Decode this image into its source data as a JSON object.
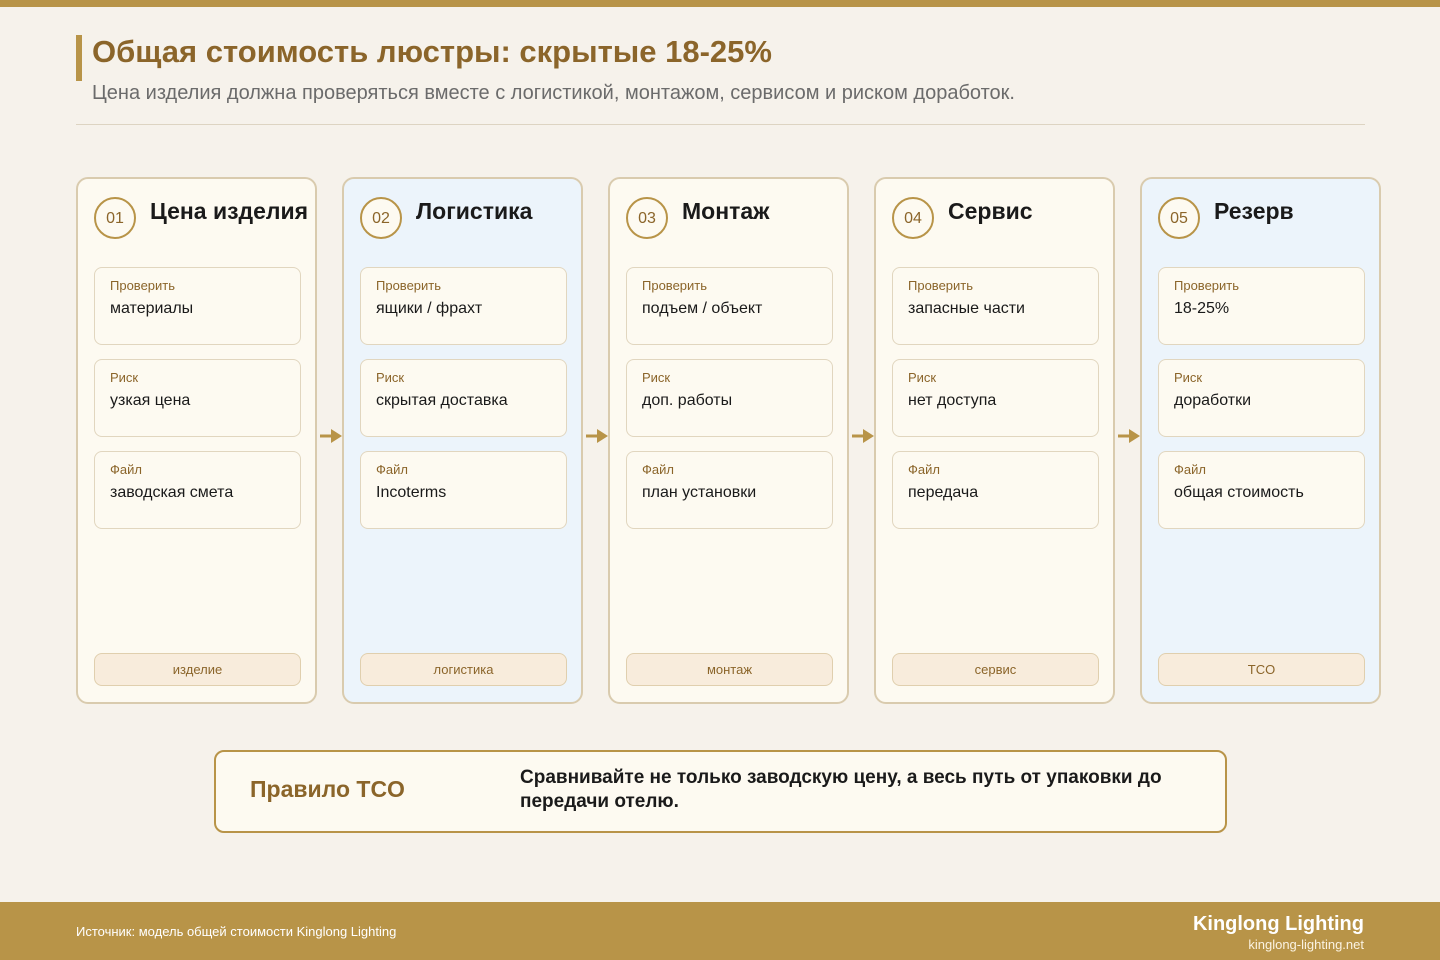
{
  "header": {
    "title": "Общая стоимость люстры: скрытые 18-25%",
    "subtitle": "Цена изделия должна проверяться вместе с логистикой, монтажом, сервисом и риском доработок."
  },
  "colors": {
    "accent": "#b89448",
    "accent_text": "#8b652a",
    "column_bg": "#fdfaf1",
    "column_bg_alt": "#ecf4fb",
    "page_bg": "#f6f2eb"
  },
  "columns": [
    {
      "num": "01",
      "title": "Цена изделия",
      "items": [
        {
          "label": "Проверить",
          "value": "материалы"
        },
        {
          "label": "Риск",
          "value": "узкая цена"
        },
        {
          "label": "Файл",
          "value": "заводская смета"
        }
      ],
      "tag": "изделие"
    },
    {
      "num": "02",
      "title": "Логистика",
      "items": [
        {
          "label": "Проверить",
          "value": "ящики / фрахт"
        },
        {
          "label": "Риск",
          "value": "скрытая доставка"
        },
        {
          "label": "Файл",
          "value": "Incoterms"
        }
      ],
      "tag": "логистика"
    },
    {
      "num": "03",
      "title": "Монтаж",
      "items": [
        {
          "label": "Проверить",
          "value": "подъем / объект"
        },
        {
          "label": "Риск",
          "value": "доп. работы"
        },
        {
          "label": "Файл",
          "value": "план установки"
        }
      ],
      "tag": "монтаж"
    },
    {
      "num": "04",
      "title": "Сервис",
      "items": [
        {
          "label": "Проверить",
          "value": "запасные части"
        },
        {
          "label": "Риск",
          "value": "нет доступа"
        },
        {
          "label": "Файл",
          "value": "передача"
        }
      ],
      "tag": "сервис"
    },
    {
      "num": "05",
      "title": "Резерв",
      "items": [
        {
          "label": "Проверить",
          "value": "18-25%"
        },
        {
          "label": "Риск",
          "value": "доработки"
        },
        {
          "label": "Файл",
          "value": "общая стоимость"
        }
      ],
      "tag": "TCO"
    }
  ],
  "rule": {
    "title": "Правило TCO",
    "text": "Сравнивайте не только заводскую цену, а весь путь от упаковки до передачи отелю."
  },
  "footer": {
    "source": "Источник: модель общей стоимости Kinglong Lighting",
    "brand": "Kinglong Lighting",
    "url": "kinglong-lighting.net"
  }
}
